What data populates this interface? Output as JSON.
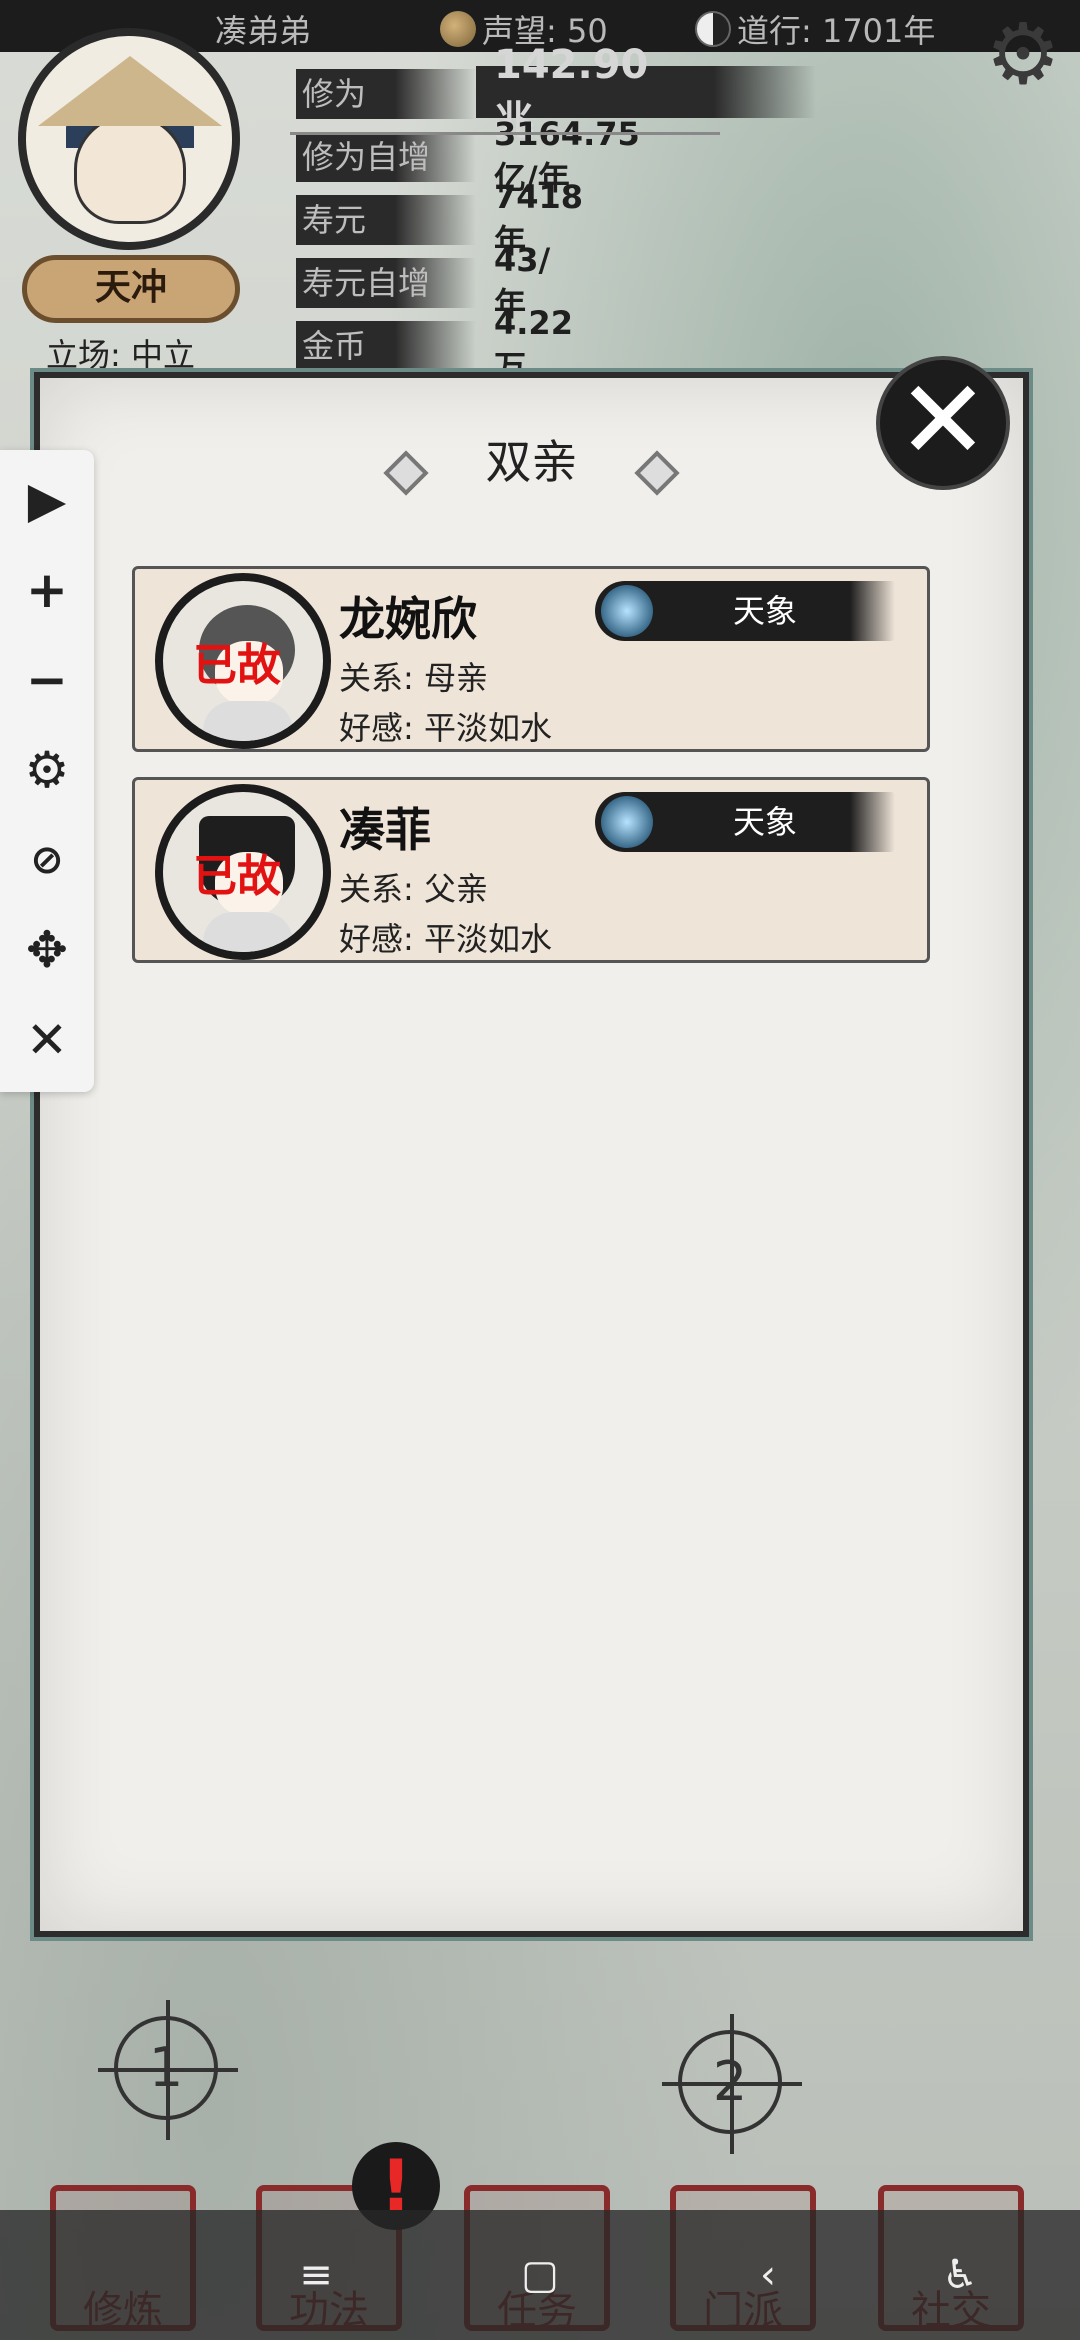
{
  "topbar": {
    "player_name": "凑弟弟",
    "reputation": "声望: 50",
    "daoxing": "道行: 1701年"
  },
  "profile": {
    "badge": "天冲",
    "stance": "立场: 中立"
  },
  "stats": [
    {
      "label": "修为",
      "value": "142.90兆"
    },
    {
      "label": "修为自增",
      "value": "3164.75亿/年"
    },
    {
      "label": "寿元",
      "value": "7418年"
    },
    {
      "label": "寿元自增",
      "value": "43/年"
    },
    {
      "label": "金币",
      "value": "4.22万"
    }
  ],
  "panel": {
    "title": "双亲",
    "cards": [
      {
        "name": "龙婉欣",
        "status": "已故",
        "realm": "天象",
        "relation": "关系: 母亲",
        "affection": "好感: 平淡如水"
      },
      {
        "name": "凑菲",
        "status": "已故",
        "realm": "天象",
        "relation": "关系: 父亲",
        "affection": "好感: 平淡如水"
      }
    ]
  },
  "markers": [
    "1",
    "2"
  ],
  "stamps": [
    "修炼",
    "功法",
    "任务",
    "门派",
    "社交"
  ],
  "navbar": {
    "menu": "≡",
    "home": "▢",
    "back": "‹",
    "accessibility": "♿"
  }
}
